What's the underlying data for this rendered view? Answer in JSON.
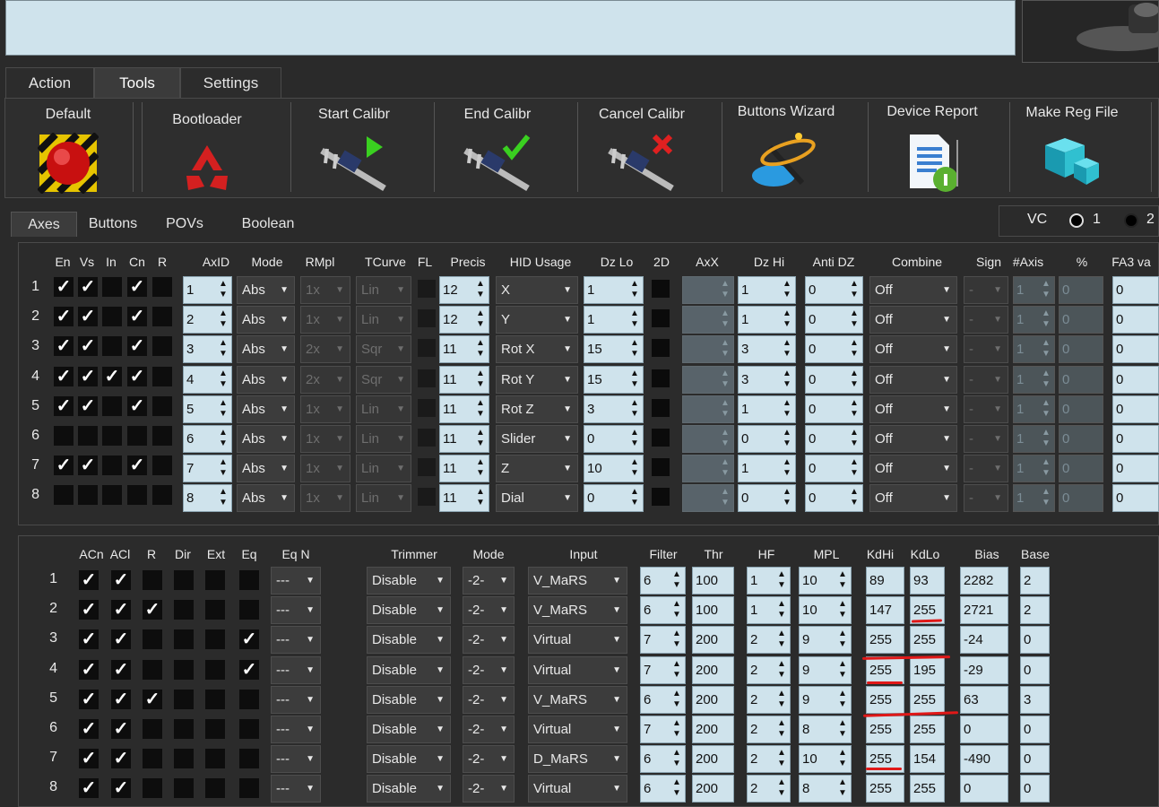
{
  "main_tabs": [
    "Action",
    "Tools",
    "Settings"
  ],
  "toolbar": {
    "default": "Default",
    "bootloader": "Bootloader",
    "start_calibr": "Start Calibr",
    "end_calibr": "End Calibr",
    "cancel_calibr": "Cancel Calibr",
    "buttons_wizard": "Buttons Wizard",
    "device_report": "Device Report",
    "make_reg_file": "Make Reg File"
  },
  "axes_tabs": [
    "Axes",
    "Buttons",
    "POVs",
    "Boolean"
  ],
  "vc": {
    "label": "VC",
    "opt1": "1",
    "opt2": "2"
  },
  "axes_headers": [
    "En",
    "Vs",
    "In",
    "Cn",
    "R",
    "AxID",
    "Mode",
    "RMpl",
    "TCurve",
    "FL",
    "Precis",
    "HID Usage",
    "Dz Lo",
    "2D",
    "AxX",
    "Dz Hi",
    "Anti DZ",
    "Combine",
    "Sign",
    "#Axis",
    "%",
    "FA3 va"
  ],
  "axes_rows": [
    {
      "n": "1",
      "en": true,
      "vs": true,
      "in": false,
      "cn": true,
      "r": false,
      "axid": "1",
      "mode": "Abs",
      "rmpl": "1x",
      "tcurve": "Lin",
      "precis": "12",
      "hid": "X",
      "dzlo": "1",
      "dzhi": "1",
      "antidz": "0",
      "combine": "Off",
      "sign": "-",
      "axis": "1",
      "pct": "0",
      "fa3": "0"
    },
    {
      "n": "2",
      "en": true,
      "vs": true,
      "in": false,
      "cn": true,
      "r": false,
      "axid": "2",
      "mode": "Abs",
      "rmpl": "1x",
      "tcurve": "Lin",
      "precis": "12",
      "hid": "Y",
      "dzlo": "1",
      "dzhi": "1",
      "antidz": "0",
      "combine": "Off",
      "sign": "-",
      "axis": "1",
      "pct": "0",
      "fa3": "0"
    },
    {
      "n": "3",
      "en": true,
      "vs": true,
      "in": false,
      "cn": true,
      "r": false,
      "axid": "3",
      "mode": "Abs",
      "rmpl": "2x",
      "tcurve": "Sqr",
      "precis": "11",
      "hid": "Rot X",
      "dzlo": "15",
      "dzhi": "3",
      "antidz": "0",
      "combine": "Off",
      "sign": "-",
      "axis": "1",
      "pct": "0",
      "fa3": "0"
    },
    {
      "n": "4",
      "en": true,
      "vs": true,
      "in": true,
      "cn": true,
      "r": false,
      "axid": "4",
      "mode": "Abs",
      "rmpl": "2x",
      "tcurve": "Sqr",
      "precis": "11",
      "hid": "Rot Y",
      "dzlo": "15",
      "dzhi": "3",
      "antidz": "0",
      "combine": "Off",
      "sign": "-",
      "axis": "1",
      "pct": "0",
      "fa3": "0"
    },
    {
      "n": "5",
      "en": true,
      "vs": true,
      "in": false,
      "cn": true,
      "r": false,
      "axid": "5",
      "mode": "Abs",
      "rmpl": "1x",
      "tcurve": "Lin",
      "precis": "11",
      "hid": "Rot Z",
      "dzlo": "3",
      "dzhi": "1",
      "antidz": "0",
      "combine": "Off",
      "sign": "-",
      "axis": "1",
      "pct": "0",
      "fa3": "0"
    },
    {
      "n": "6",
      "en": false,
      "vs": false,
      "in": false,
      "cn": false,
      "r": false,
      "axid": "6",
      "mode": "Abs",
      "rmpl": "1x",
      "tcurve": "Lin",
      "precis": "11",
      "hid": "Slider",
      "dzlo": "0",
      "dzhi": "0",
      "antidz": "0",
      "combine": "Off",
      "sign": "-",
      "axis": "1",
      "pct": "0",
      "fa3": "0"
    },
    {
      "n": "7",
      "en": true,
      "vs": true,
      "in": false,
      "cn": true,
      "r": false,
      "axid": "7",
      "mode": "Abs",
      "rmpl": "1x",
      "tcurve": "Lin",
      "precis": "11",
      "hid": "Z",
      "dzlo": "10",
      "dzhi": "1",
      "antidz": "0",
      "combine": "Off",
      "sign": "-",
      "axis": "1",
      "pct": "0",
      "fa3": "0"
    },
    {
      "n": "8",
      "en": false,
      "vs": false,
      "in": false,
      "cn": false,
      "r": false,
      "axid": "8",
      "mode": "Abs",
      "rmpl": "1x",
      "tcurve": "Lin",
      "precis": "11",
      "hid": "Dial",
      "dzlo": "0",
      "dzhi": "0",
      "antidz": "0",
      "combine": "Off",
      "sign": "-",
      "axis": "1",
      "pct": "0",
      "fa3": "0"
    }
  ],
  "bottom_headers": [
    "ACn",
    "ACl",
    "R",
    "Dir",
    "Ext",
    "Eq",
    "Eq N",
    "Trimmer",
    "Mode",
    "Input",
    "Filter",
    "Thr",
    "HF",
    "MPL",
    "KdHi",
    "KdLo",
    "Bias",
    "Base"
  ],
  "bottom_rows": [
    {
      "n": "1",
      "acn": true,
      "acl": true,
      "r": false,
      "eq": false,
      "eqn": "---",
      "trimmer": "Disable",
      "mode": "-2-",
      "input": "V_MaRS",
      "filter": "6",
      "thr": "100",
      "hf": "1",
      "mpl": "10",
      "kdhi": "89",
      "kdlo": "93",
      "bias": "2282",
      "base": "2"
    },
    {
      "n": "2",
      "acn": true,
      "acl": true,
      "r": true,
      "eq": false,
      "eqn": "---",
      "trimmer": "Disable",
      "mode": "-2-",
      "input": "V_MaRS",
      "filter": "6",
      "thr": "100",
      "hf": "1",
      "mpl": "10",
      "kdhi": "147",
      "kdlo": "255",
      "bias": "2721",
      "base": "2"
    },
    {
      "n": "3",
      "acn": true,
      "acl": true,
      "r": false,
      "eq": true,
      "eqn": "---",
      "trimmer": "Disable",
      "mode": "-2-",
      "input": "Virtual",
      "filter": "7",
      "thr": "200",
      "hf": "2",
      "mpl": "9",
      "kdhi": "255",
      "kdlo": "255",
      "bias": "-24",
      "base": "0"
    },
    {
      "n": "4",
      "acn": true,
      "acl": true,
      "r": false,
      "eq": true,
      "eqn": "---",
      "trimmer": "Disable",
      "mode": "-2-",
      "input": "Virtual",
      "filter": "7",
      "thr": "200",
      "hf": "2",
      "mpl": "9",
      "kdhi": "255",
      "kdlo": "195",
      "bias": "-29",
      "base": "0"
    },
    {
      "n": "5",
      "acn": true,
      "acl": true,
      "r": true,
      "eq": false,
      "eqn": "---",
      "trimmer": "Disable",
      "mode": "-2-",
      "input": "V_MaRS",
      "filter": "6",
      "thr": "200",
      "hf": "2",
      "mpl": "9",
      "kdhi": "255",
      "kdlo": "255",
      "bias": "63",
      "base": "3"
    },
    {
      "n": "6",
      "acn": true,
      "acl": true,
      "r": false,
      "eq": false,
      "eqn": "---",
      "trimmer": "Disable",
      "mode": "-2-",
      "input": "Virtual",
      "filter": "7",
      "thr": "200",
      "hf": "2",
      "mpl": "8",
      "kdhi": "255",
      "kdlo": "255",
      "bias": "0",
      "base": "0"
    },
    {
      "n": "7",
      "acn": true,
      "acl": true,
      "r": false,
      "eq": false,
      "eqn": "---",
      "trimmer": "Disable",
      "mode": "-2-",
      "input": "D_MaRS",
      "filter": "6",
      "thr": "200",
      "hf": "2",
      "mpl": "10",
      "kdhi": "255",
      "kdlo": "154",
      "bias": "-490",
      "base": "0"
    },
    {
      "n": "8",
      "acn": true,
      "acl": true,
      "r": false,
      "eq": false,
      "eqn": "---",
      "trimmer": "Disable",
      "mode": "-2-",
      "input": "Virtual",
      "filter": "6",
      "thr": "200",
      "hf": "2",
      "mpl": "8",
      "kdhi": "255",
      "kdlo": "255",
      "bias": "0",
      "base": "0"
    }
  ],
  "colors": {
    "field": "#cfe3ec",
    "annotation": "#e01818",
    "panel": "#2b2b2b"
  }
}
